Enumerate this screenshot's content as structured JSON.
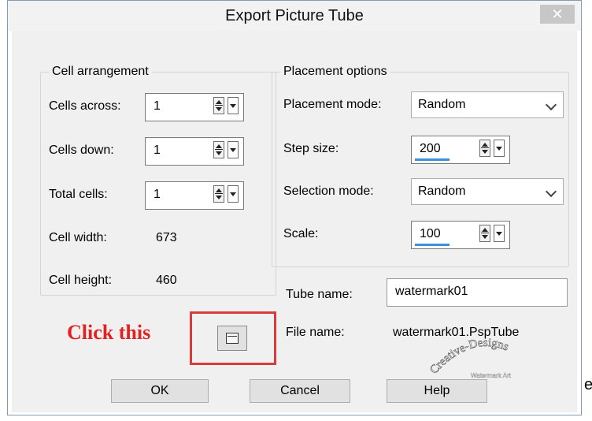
{
  "dialog": {
    "title": "Export Picture Tube",
    "close_glyph": "✕"
  },
  "cell_arrangement": {
    "legend": "Cell arrangement",
    "cells_across_label": "Cells across:",
    "cells_across_value": "1",
    "cells_down_label": "Cells down:",
    "cells_down_value": "1",
    "total_cells_label": "Total cells:",
    "total_cells_value": "1",
    "cell_width_label": "Cell width:",
    "cell_width_value": "673",
    "cell_height_label": "Cell height:",
    "cell_height_value": "460"
  },
  "placement_options": {
    "legend": "Placement options",
    "placement_mode_label": "Placement mode:",
    "placement_mode_value": "Random",
    "step_size_label": "Step size:",
    "step_size_value": "200",
    "selection_mode_label": "Selection mode:",
    "selection_mode_value": "Random",
    "scale_label": "Scale:",
    "scale_value": "100"
  },
  "tube": {
    "tube_name_label": "Tube name:",
    "tube_name_value": "watermark01",
    "file_name_label": "File name:",
    "file_name_value": "watermark01.PspTube"
  },
  "annotation": {
    "click_text": "Click this",
    "color": "#e52020"
  },
  "buttons": {
    "ok": "OK",
    "cancel": "Cancel",
    "help": "Help"
  },
  "edge_char": "e",
  "watermark": {
    "line1": "Creative-Designs",
    "line2": "Watermark Art"
  },
  "icons": {
    "browse": "folder-icon",
    "close": "close-icon",
    "dropdown": "chevron-down-icon",
    "spin": "spin-arrows-icon"
  },
  "colors": {
    "accent": "#3b8ee0",
    "highlight_box": "#d83b3b"
  }
}
